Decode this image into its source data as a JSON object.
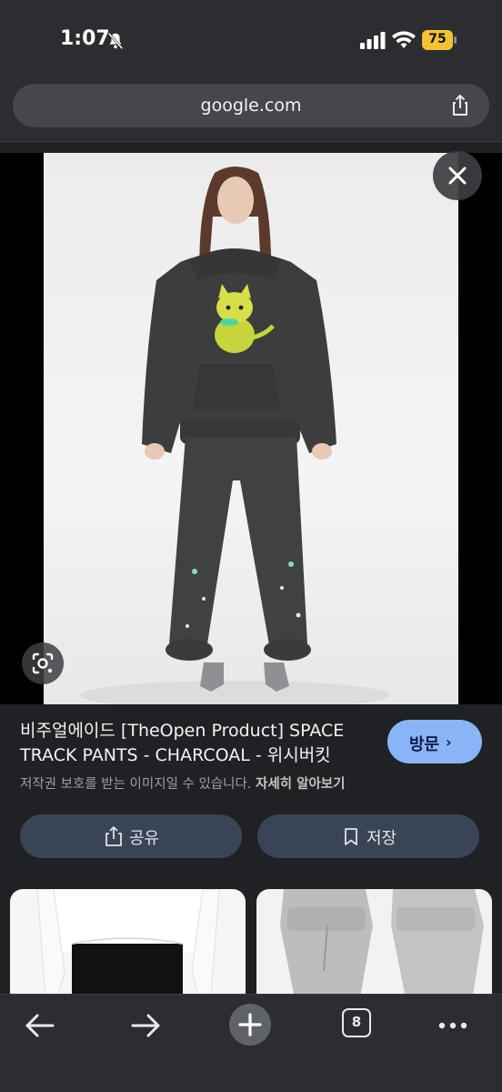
{
  "status_bar": {
    "time": "1:07",
    "battery_level": "75",
    "icons": [
      "bell-slash-icon",
      "cellular-signal-icon",
      "wifi-icon",
      "battery-icon"
    ]
  },
  "browser": {
    "url": "google.com"
  },
  "viewer": {
    "icons": [
      "close-icon",
      "google-lens-icon"
    ]
  },
  "result": {
    "title": "비주얼에이드 [TheOpen Product] SPACE TRACK PANTS - CHARCOAL - 위시버킷",
    "visit_label": "방문",
    "visit_chevron": "›",
    "copyright_notice": "저작권 보호를 받는 이미지일 수 있습니다.",
    "learn_more": "자세히 알아보기",
    "share_label": "공유",
    "save_label": "저장"
  },
  "toolbar": {
    "tab_count": "8"
  },
  "colors": {
    "background": "#202124",
    "chrome": "#2c2d30",
    "accent_button": "#8ab4f8",
    "action_button": "#394457",
    "battery": "#f4c430"
  }
}
